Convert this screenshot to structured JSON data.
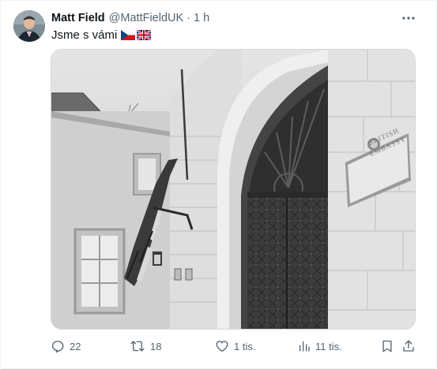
{
  "author": {
    "name": "Matt Field",
    "handle": "@MattFieldUK",
    "separator": "·",
    "time": "1 h"
  },
  "tweet": {
    "text": "Jsme s vámi",
    "emoji_flags": [
      "czech-flag-icon",
      "uk-flag-icon"
    ]
  },
  "media": {
    "sign_line1": "BRITISH",
    "sign_line2": "EMBASSY"
  },
  "actions": {
    "replies": "22",
    "reposts": "18",
    "likes": "1 tis.",
    "views": "11 tis."
  },
  "colors": {
    "text_primary": "#0f1419",
    "text_secondary": "#536471",
    "border": "#cfd9de"
  },
  "icons": [
    "more-icon",
    "reply-icon",
    "repost-icon",
    "like-icon",
    "views-icon",
    "bookmark-icon",
    "share-icon"
  ]
}
